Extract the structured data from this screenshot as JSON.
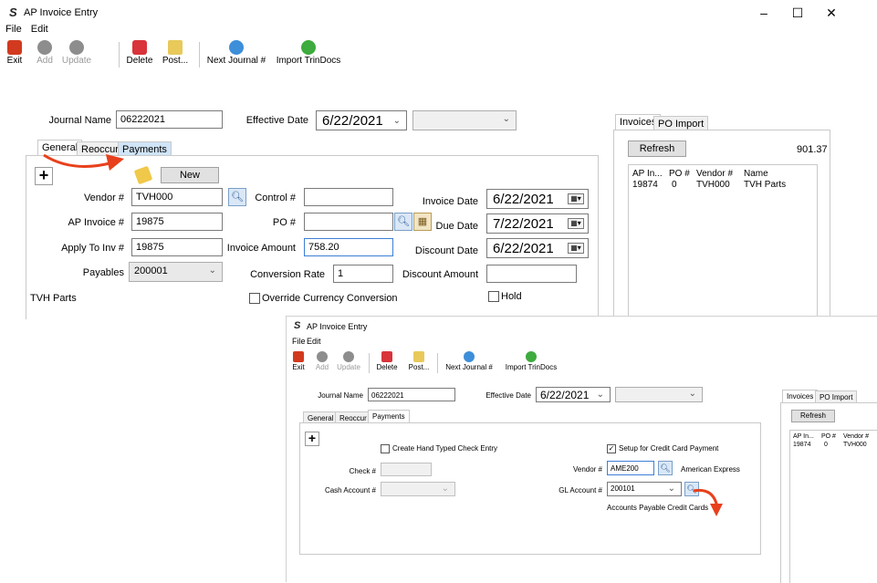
{
  "back": {
    "title": "AP Invoice Entry",
    "menu": [
      "File",
      "Edit"
    ],
    "toolbar": [
      "Exit",
      "Add",
      "Update",
      "Delete",
      "Post...",
      "Next Journal #",
      "Import TrinDocs"
    ],
    "journal_label": "Journal Name",
    "journal_value": "06222021",
    "effective_label": "Effective Date",
    "effective_value": "6/22/2021",
    "tabs": [
      "General",
      "Reoccur",
      "Payments"
    ],
    "new_button": "New",
    "vendor_label": "Vendor #",
    "vendor_value": "TVH000",
    "apinv_label": "AP Invoice #",
    "apinv_value": "19875",
    "applyto_label": "Apply To Inv #",
    "applyto_value": "19875",
    "payables_label": "Payables",
    "payables_value": "200001",
    "vendor_name": "TVH Parts",
    "control_label": "Control #",
    "po_label": "PO #",
    "amount_label": "Invoice Amount",
    "amount_value": "758.20",
    "conversion_label": "Conversion Rate",
    "conversion_value": "1",
    "override_label": "Override Currency Conversion",
    "invdate_label": "Invoice Date",
    "invdate_value": "6/22/2021",
    "duedate_label": "Due Date",
    "duedate_value": "7/22/2021",
    "discdate_label": "Discount Date",
    "discdate_value": "6/22/2021",
    "discamt_label": "Discount Amount",
    "hold_label": "Hold",
    "right_tabs": [
      "Invoices",
      "PO Import"
    ],
    "refresh": "Refresh",
    "total": "901.37",
    "grid_headers": [
      "AP In...",
      "PO #",
      "Vendor #",
      "Name"
    ],
    "grid_row": [
      "19874",
      "0",
      "TVH000",
      "TVH Parts"
    ]
  },
  "front": {
    "title": "AP Invoice Entry",
    "menu": [
      "File",
      "Edit"
    ],
    "toolbar": [
      "Exit",
      "Add",
      "Update",
      "Delete",
      "Post...",
      "Next Journal #",
      "Import TrinDocs"
    ],
    "journal_label": "Journal Name",
    "journal_value": "06222021",
    "effective_label": "Effective Date",
    "effective_value": "6/22/2021",
    "tabs": [
      "General",
      "Reoccur",
      "Payments"
    ],
    "hand_typed_label": "Create Hand Typed Check Entry",
    "check_label": "Check #",
    "cash_label": "Cash Account #",
    "cc_label": "Setup for Credit Card Payment",
    "vendor_label": "Vendor #",
    "vendor_value": "AME200",
    "vendor_name": "American Express",
    "gl_label": "GL Account #",
    "gl_value": "200101",
    "gl_name": "Accounts Payable Credit Cards",
    "right_tabs": [
      "Invoices",
      "PO Import"
    ],
    "refresh": "Refresh",
    "grid_headers": [
      "AP In...",
      "PO #",
      "Vendor #"
    ],
    "grid_row": [
      "19874",
      "0",
      "TVH000"
    ]
  },
  "colors": {
    "arrow": "#e8401c",
    "exit_icon": "#d23a1f",
    "delete_icon": "#d8343a"
  }
}
